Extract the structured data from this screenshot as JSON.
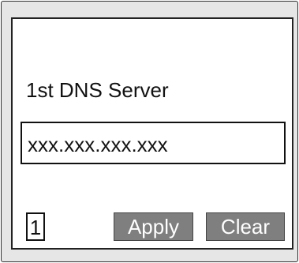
{
  "screen": {
    "field_label": "1st DNS Server",
    "ip_value": "xxx.xxx.xxx.xxx",
    "page_number": "1",
    "apply_label": "Apply",
    "clear_label": "Clear"
  },
  "colors": {
    "frame_background": "#e6e6e6",
    "screen_background": "#ffffff",
    "button_background": "#7f7f7f",
    "button_text": "#ffffff",
    "text": "#111111"
  }
}
